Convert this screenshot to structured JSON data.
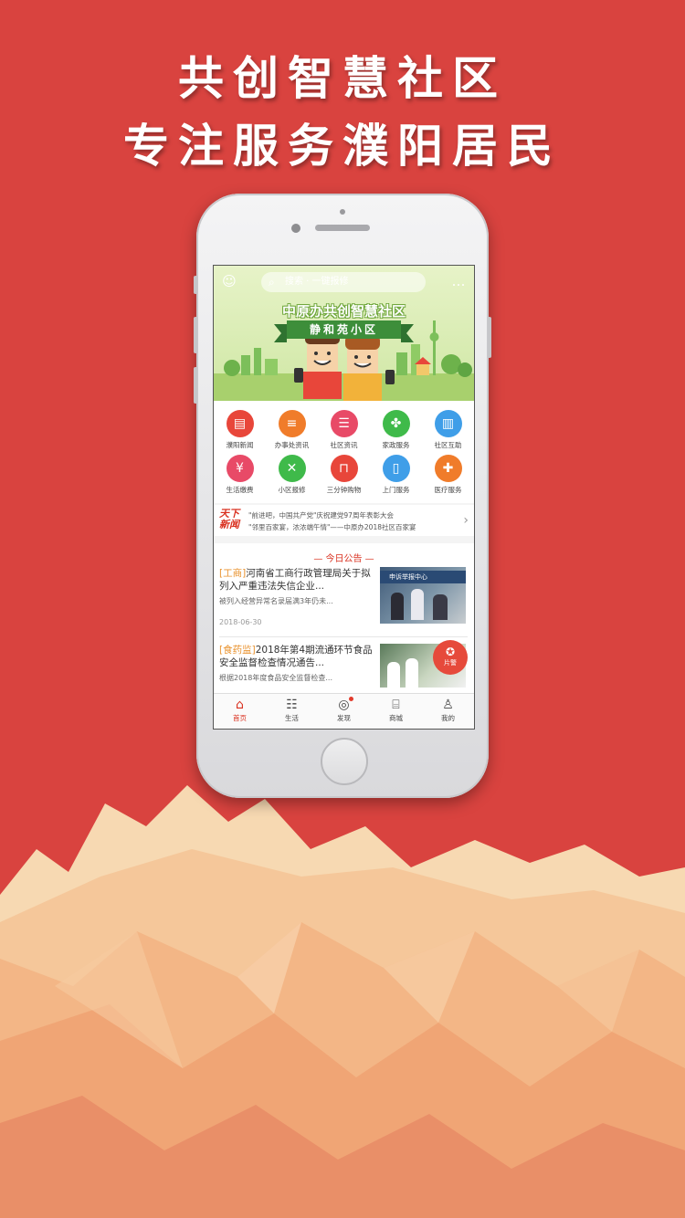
{
  "promo": {
    "headline_1": "共创智慧社区",
    "headline_2": "专注服务濮阳居民"
  },
  "colors": {
    "background_red": "#d9433f",
    "accent_red": "#d9301f",
    "tag_orange": "#e9932f",
    "banner_green": "#3d8e3a"
  },
  "app": {
    "header": {
      "left_icon": "smile-icon",
      "search_placeholder": "搜索 · 一键报修",
      "right_icon": "message-icon"
    },
    "banner": {
      "title": "中原办共创智慧社区",
      "ribbon": "静和苑小区"
    },
    "services": [
      {
        "label": "濮阳新闻",
        "icon": "news-icon",
        "color": "#e8463a"
      },
      {
        "label": "办事处资讯",
        "icon": "document-icon",
        "color": "#f07c2a"
      },
      {
        "label": "社区资讯",
        "icon": "newspaper-icon",
        "color": "#e84a67"
      },
      {
        "label": "家政服务",
        "icon": "clover-icon",
        "color": "#3fba4a"
      },
      {
        "label": "社区互助",
        "icon": "building-icon",
        "color": "#3f9ee8"
      },
      {
        "label": "生活缴费",
        "icon": "bill-icon",
        "color": "#e84a67"
      },
      {
        "label": "小区报修",
        "icon": "tools-icon",
        "color": "#3fba4a"
      },
      {
        "label": "三分钟购物",
        "icon": "shopping-bag-icon",
        "color": "#e8463a"
      },
      {
        "label": "上门服务",
        "icon": "door-icon",
        "color": "#3f9ee8"
      },
      {
        "label": "医疗服务",
        "icon": "medical-kit-icon",
        "color": "#f07c2a"
      }
    ],
    "news_ticker": {
      "logo_line1": "天下",
      "logo_line2": "新闻",
      "items": [
        "\"前进吧，中国共产党\"庆祝建党97周年表彰大会",
        "\"邻里百家宴，浓浓端午情\"——中原办2018社区百家宴"
      ]
    },
    "announcements": {
      "title": "— 今日公告 —",
      "articles": [
        {
          "tag": "[工商]",
          "title": "河南省工商行政管理局关于拟列入严重违法失信企业...",
          "desc": "被列入经营异常名录届满3年仍未...",
          "date": "2018-06-30",
          "image_text": "申诉举报中心"
        },
        {
          "tag": "[食药监]",
          "title": "2018年第4期流通环节食品安全监督检查情况通告...",
          "desc": "根据2018年度食品安全监督检查...",
          "date": ""
        }
      ]
    },
    "floating_button": {
      "label": "片警",
      "icon": "police-badge-icon"
    },
    "tabs": [
      {
        "label": "首页",
        "icon": "home-icon",
        "active": true
      },
      {
        "label": "生活",
        "icon": "basket-icon",
        "active": false
      },
      {
        "label": "发现",
        "icon": "compass-icon",
        "active": false,
        "badge": true
      },
      {
        "label": "商城",
        "icon": "store-icon",
        "active": false
      },
      {
        "label": "我的",
        "icon": "user-icon",
        "active": false
      }
    ]
  }
}
